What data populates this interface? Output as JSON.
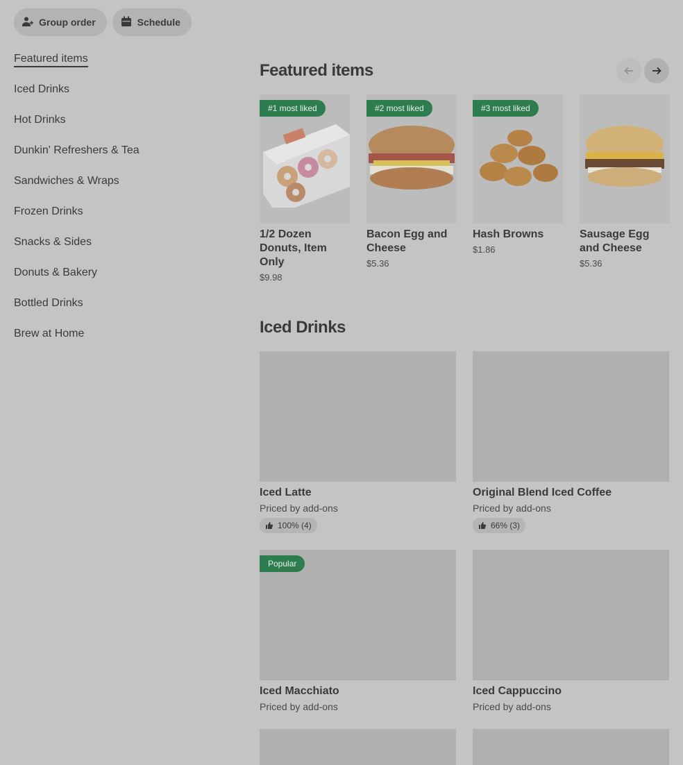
{
  "top_actions": {
    "group_order_label": "Group order",
    "schedule_label": "Schedule"
  },
  "sidebar": {
    "items": [
      {
        "label": "Featured items"
      },
      {
        "label": "Iced Drinks"
      },
      {
        "label": "Hot Drinks"
      },
      {
        "label": "Dunkin' Refreshers & Tea"
      },
      {
        "label": "Sandwiches & Wraps"
      },
      {
        "label": "Frozen Drinks"
      },
      {
        "label": "Snacks & Sides"
      },
      {
        "label": "Donuts & Bakery"
      },
      {
        "label": "Bottled Drinks"
      },
      {
        "label": "Brew at Home"
      }
    ]
  },
  "featured": {
    "title": "Featured items",
    "items": [
      {
        "badge": "#1 most liked",
        "name": "1/2 Dozen Donuts, Item Only",
        "price": "$9.98",
        "image": "donut-box"
      },
      {
        "badge": "#2 most liked",
        "name": "Bacon Egg and Cheese",
        "price": "$5.36",
        "image": "bagel-sandwich"
      },
      {
        "badge": "#3 most liked",
        "name": "Hash Browns",
        "price": "$1.86",
        "image": "hash-browns"
      },
      {
        "badge": "",
        "name": "Sausage Egg and Cheese",
        "price": "$5.36",
        "image": "muffin-sandwich"
      }
    ]
  },
  "iced_drinks": {
    "title": "Iced Drinks",
    "items": [
      {
        "name": "Iced Latte",
        "price": "Priced by add-ons",
        "rating": "100% (4)",
        "badge": ""
      },
      {
        "name": "Original Blend Iced Coffee",
        "price": "Priced by add-ons",
        "rating": "66% (3)",
        "badge": ""
      },
      {
        "name": "Iced Macchiato",
        "price": "Priced by add-ons",
        "rating": "",
        "badge": "Popular"
      },
      {
        "name": "Iced Cappuccino",
        "price": "Priced by add-ons",
        "rating": "",
        "badge": ""
      }
    ]
  },
  "colors": {
    "overlay_bg": "#c4c4c4",
    "badge_green": "#2e7d4f",
    "text": "#3a3a3a"
  }
}
